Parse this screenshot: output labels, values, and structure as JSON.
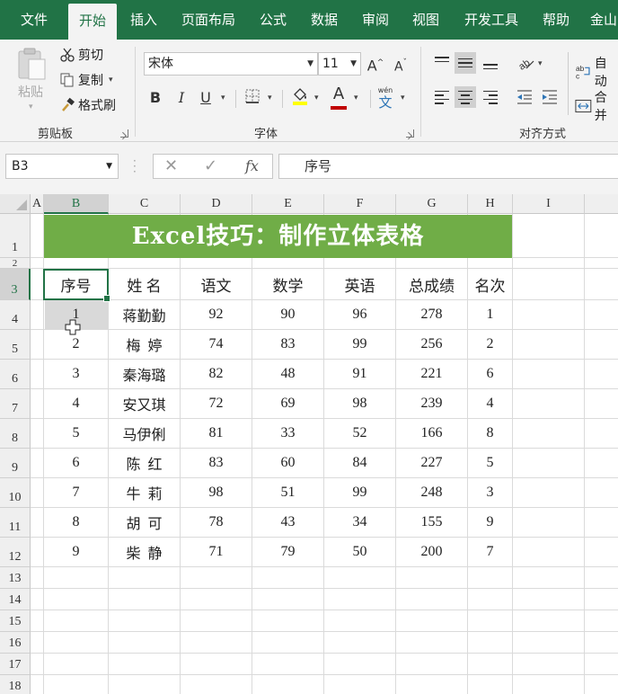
{
  "ribbon_tabs": [
    "文件",
    "开始",
    "插入",
    "页面布局",
    "公式",
    "数据",
    "审阅",
    "视图",
    "开发工具",
    "帮助",
    "金山"
  ],
  "active_tab": "开始",
  "clipboard": {
    "paste": "粘贴",
    "cut": "剪切",
    "copy": "复制",
    "format_painter": "格式刷",
    "group_label": "剪贴板"
  },
  "font": {
    "name": "宋体",
    "size": "11",
    "grow_icon": "A",
    "shrink_icon": "A",
    "bold": "B",
    "italic": "I",
    "underline": "U",
    "font_color_icon": "A",
    "phonetic_top": "wén",
    "phonetic_bottom": "文",
    "group_label": "字体"
  },
  "alignment": {
    "wrap": "自动",
    "merge": "合并",
    "group_label": "对齐方式"
  },
  "formula_bar": {
    "name_box": "B3",
    "cancel": "✕",
    "enter": "✓",
    "fx": "fx",
    "content": "序号"
  },
  "sheet": {
    "columns": [
      "A",
      "B",
      "C",
      "D",
      "E",
      "F",
      "G",
      "H",
      "I"
    ],
    "rows": [
      "1",
      "2",
      "3",
      "4",
      "5",
      "6",
      "7",
      "8",
      "9",
      "10",
      "11",
      "12",
      "13",
      "14",
      "15",
      "16",
      "17",
      "18"
    ],
    "selected_cell": "B3",
    "title": "Excel技巧：制作立体表格",
    "headers": [
      "序号",
      "姓 名",
      "语文",
      "数学",
      "英语",
      "总成绩",
      "名次"
    ],
    "data": [
      [
        "1",
        "蒋勤勤",
        "92",
        "90",
        "96",
        "278",
        "1"
      ],
      [
        "2",
        "梅  婷",
        "74",
        "83",
        "99",
        "256",
        "2"
      ],
      [
        "3",
        "秦海璐",
        "82",
        "48",
        "91",
        "221",
        "6"
      ],
      [
        "4",
        "安又琪",
        "72",
        "69",
        "98",
        "239",
        "4"
      ],
      [
        "5",
        "马伊俐",
        "81",
        "33",
        "52",
        "166",
        "8"
      ],
      [
        "6",
        "陈  红",
        "83",
        "60",
        "84",
        "227",
        "5"
      ],
      [
        "7",
        "牛  莉",
        "98",
        "51",
        "99",
        "248",
        "3"
      ],
      [
        "8",
        "胡  可",
        "78",
        "43",
        "34",
        "155",
        "9"
      ],
      [
        "9",
        "柴  静",
        "71",
        "79",
        "50",
        "200",
        "7"
      ]
    ]
  },
  "colors": {
    "excel_green": "#217346",
    "title_fill": "#70ad47"
  }
}
